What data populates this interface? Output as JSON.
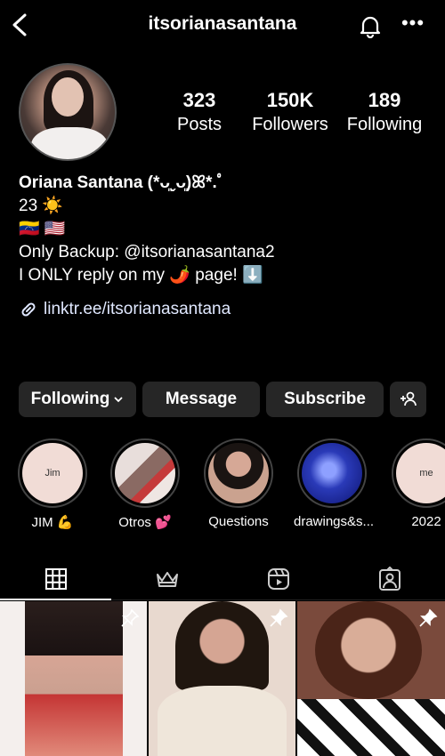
{
  "header": {
    "username": "itsorianasantana"
  },
  "stats": [
    {
      "value": "323",
      "label": "Posts"
    },
    {
      "value": "150K",
      "label": "Followers"
    },
    {
      "value": "189",
      "label": "Following"
    }
  ],
  "bio": {
    "name": "Oriana Santana (*ᴗ͈ˬᴗ͈)ꕤ*.ﾟ",
    "line1": "23 ☀️",
    "flags": "🇻🇪 🇺🇸",
    "line3": "Only Backup: @itsorianasantana2",
    "line4": "I ONLY reply on my 🌶️ page! ⬇️",
    "link": "linktr.ee/itsorianasantana"
  },
  "buttons": {
    "following": "Following",
    "message": "Message",
    "subscribe": "Subscribe"
  },
  "highlights": [
    {
      "label": "JIM 💪",
      "inner_text": "Jim",
      "bg": "#f1dcd6"
    },
    {
      "label": "Otros 💕",
      "inner_text": "",
      "bg": "#d9c7c2"
    },
    {
      "label": "Questions",
      "inner_text": "",
      "bg": "#5a4640"
    },
    {
      "label": "drawings&s...",
      "inner_text": "",
      "bg": "#2332a8"
    },
    {
      "label": "2022",
      "inner_text": "me",
      "bg": "#f1dcd6"
    }
  ],
  "tabs": [
    "grid-icon",
    "crown-icon",
    "reels-icon",
    "tagged-icon"
  ],
  "posts": [
    {
      "colors": [
        "#f3eeec",
        "#c2685a",
        "#d43a3a"
      ]
    },
    {
      "colors": [
        "#ead9cf",
        "#c99985",
        "#f1ebe4"
      ]
    },
    {
      "colors": [
        "#8a5646",
        "#caa08a",
        "#ffffff"
      ]
    }
  ]
}
